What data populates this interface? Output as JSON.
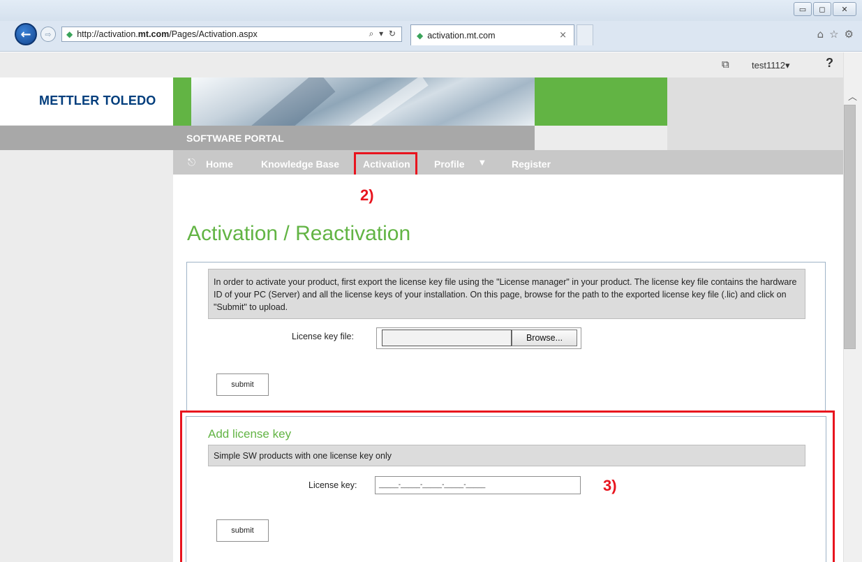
{
  "browser": {
    "url": "http://activation.mt.com/Pages/Activation.aspx",
    "url_prefix": "http://activation.",
    "url_bold": "mt.com",
    "url_suffix": "/Pages/Activation.aspx",
    "tab_title": "activation.mt.com",
    "address_tools": "⌕ ▾ ↻",
    "tab_close": "×"
  },
  "window_controls": {
    "minimize": "▭",
    "maximize": "◻",
    "close": "✕"
  },
  "toolbar": {
    "user": "test1112▾",
    "help": "?",
    "fullscreen_icon": "⧉"
  },
  "site": {
    "logo": "METTLER TOLEDO",
    "portal_title": "SOFTWARE PORTAL",
    "nav": [
      {
        "label": "Home"
      },
      {
        "label": "Knowledge Base"
      },
      {
        "label": "Activation"
      },
      {
        "label": "Profile"
      },
      {
        "label": "Register"
      }
    ]
  },
  "annotations": {
    "step2": "2)",
    "step3": "3)"
  },
  "page": {
    "title": "Activation / Reactivation",
    "panel1": {
      "info": "In order to activate your product, first export the license key file using the \"License manager\" in your product. The license key file contains the hardware ID of your PC (Server) and all the license keys of your installation. On this page, browse for the path to the exported license key file (.lic) and click on \"Submit\" to upload.",
      "file_label": "License key file:",
      "browse_label": "Browse...",
      "submit_label": "submit"
    },
    "panel2": {
      "title": "Add license key",
      "info": "Simple SW products with one license key only",
      "key_label": "License key:",
      "key_placeholder": "_____-_____-_____-_____-_____",
      "submit_label": "submit"
    }
  },
  "colors": {
    "brand_blue": "#003d7c",
    "brand_green": "#62b444",
    "annotation_red": "#e8141e"
  }
}
